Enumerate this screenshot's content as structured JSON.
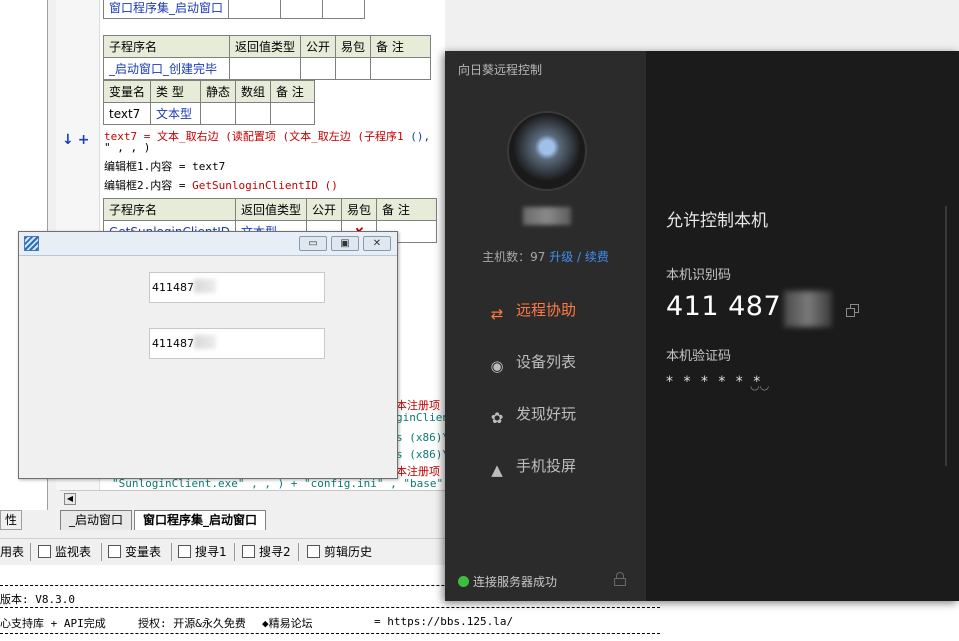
{
  "ide": {
    "left_tab": "性",
    "table1": {
      "row": [
        "窗口程序集_启动窗口",
        "",
        "",
        ""
      ]
    },
    "table2": {
      "headers": [
        "子程序名",
        "返回值类型",
        "公开",
        "易包",
        "备 注"
      ],
      "row": [
        "_启动窗口_创建完毕",
        "",
        "",
        "",
        ""
      ]
    },
    "table3": {
      "headers": [
        "变量名",
        "类 型",
        "静态",
        "数组",
        "备 注"
      ],
      "row": [
        "text7",
        "文本型",
        "",
        "",
        ""
      ]
    },
    "code": {
      "line1_var": "text7",
      "line1_rest": " = 文本_取右边 (读配置项 (文本_取左边 (子程序1 ",
      "line1_tail": "(),",
      "line2": "\" , , )",
      "line3": "编辑框1.内容 = text7",
      "line4_prefix": "编辑框2.内容 = ",
      "line4_call": "GetSunloginClientID ()"
    },
    "table4": {
      "headers": [
        "子程序名",
        "返回值类型",
        "公开",
        "易包",
        "备 注"
      ],
      "row": [
        "GetSunloginClientID",
        "文本型",
        "",
        "✘",
        ""
      ]
    },
    "hidden_code": {
      "a": "本注册项",
      "b": "ginClien",
      "c": "s (x86)\\",
      "d": "s (x86)\\",
      "e": "本注册项",
      "f": "\"SunloginClient.exe\" , , ) + \"config.ini\" , \"base\" ,"
    },
    "tabs": [
      "_启动窗口",
      "窗口程序集_启动窗口"
    ],
    "toolbar": [
      "用表",
      "监视表",
      "变量表",
      "搜寻1",
      "搜寻2",
      "剪辑历史"
    ],
    "status": {
      "line1": "版本: V8.3.0",
      "line2_a": "心支持库 + API完成",
      "line2_b": "授权: 开源&永久免费",
      "line2_c": "◆精易论坛",
      "line2_d": "= https://bbs.125.la/"
    }
  },
  "dialog": {
    "field1": "411487",
    "field2": "411487",
    "minimize": "▭",
    "maximize": "▣",
    "close": "✕"
  },
  "sunlogin": {
    "title": "向日葵远程控制",
    "hosts_prefix": "主机数：97",
    "upgrade": "升级",
    "separator": " / ",
    "renew": "续费",
    "nav": [
      {
        "label": "远程协助",
        "icon": "⇄",
        "active": true
      },
      {
        "label": "设备列表",
        "icon": "◉",
        "active": false
      },
      {
        "label": "发现好玩",
        "icon": "✿",
        "active": false
      },
      {
        "label": "手机投屏",
        "icon": "▲",
        "active": false
      }
    ],
    "connection": "连接服务器成功",
    "allow_title": "允许控制本机",
    "id_label": "本机识别码",
    "id_value": "411 487",
    "pwd_label": "本机验证码",
    "pwd_value": "* * * * * *",
    "eye": "◡◡",
    "colors": {
      "accent": "#ff7a45",
      "link": "#3f8ff0",
      "online": "#3dbe3d"
    }
  }
}
